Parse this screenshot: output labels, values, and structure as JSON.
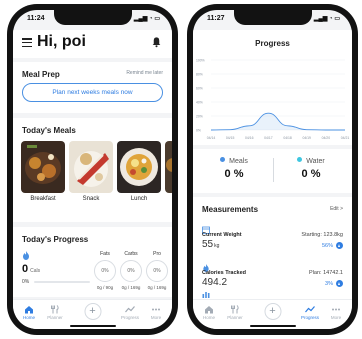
{
  "left": {
    "status_time": "11:24",
    "greeting": "Hi, poi",
    "meal_prep": {
      "title": "Meal Prep",
      "remind_label": "Remind me later",
      "button_label": "Plan next weeks meals now"
    },
    "todays_meals": {
      "title": "Today's Meals",
      "items": [
        {
          "label": "Breakfast"
        },
        {
          "label": "Snack"
        },
        {
          "label": "Lunch"
        }
      ]
    },
    "progress": {
      "title": "Today's Progress",
      "calories_value": "0",
      "calories_unit": "Cals",
      "calories_pct": "0%",
      "macros": [
        {
          "name": "Fats",
          "pct": "0%",
          "amount": "0g / 90g"
        },
        {
          "name": "Carbs",
          "pct": "0%",
          "amount": "0g / 169g"
        },
        {
          "name": "Pro",
          "pct": "0%",
          "amount": "0g / 169g"
        }
      ]
    },
    "tabs": [
      {
        "label": "Home",
        "active": true
      },
      {
        "label": "Planner",
        "active": false
      },
      {
        "label": "Progress",
        "active": false
      },
      {
        "label": "More",
        "active": false
      }
    ]
  },
  "right": {
    "status_time": "11:27",
    "title": "Progress",
    "chart_data": {
      "type": "area",
      "x": [
        "04/14",
        "04/15",
        "04/16",
        "04/17",
        "04/18",
        "04/19",
        "04/20",
        "04/21"
      ],
      "y_ticks": [
        "100%",
        "80%",
        "60%",
        "40%",
        "20%",
        "0%"
      ],
      "ylim": [
        0,
        100
      ],
      "series": [
        {
          "values": [
            0,
            0.5,
            6,
            24,
            6,
            0.5,
            0,
            0
          ],
          "color": "#4a90e2"
        }
      ],
      "grid": true
    },
    "stats": [
      {
        "label": "Meals",
        "value": "0 %",
        "color": "#4a90e2"
      },
      {
        "label": "Water",
        "value": "0 %",
        "color": "#3ec6e0"
      }
    ],
    "measurements": {
      "title": "Measurements",
      "edit_label": "Edit >",
      "rows": [
        {
          "label": "Current Weight",
          "value": "55",
          "unit": "kg",
          "aside": "Starting: 123.8kg",
          "pct": "56%"
        },
        {
          "label": "Calories Tracked",
          "value": "494.2",
          "unit": "",
          "aside": "Plan: 14742.1",
          "pct": "3%"
        }
      ]
    },
    "tabs": [
      {
        "label": "Home",
        "active": false
      },
      {
        "label": "Planner",
        "active": false
      },
      {
        "label": "Progress",
        "active": true
      },
      {
        "label": "More",
        "active": false
      }
    ]
  }
}
